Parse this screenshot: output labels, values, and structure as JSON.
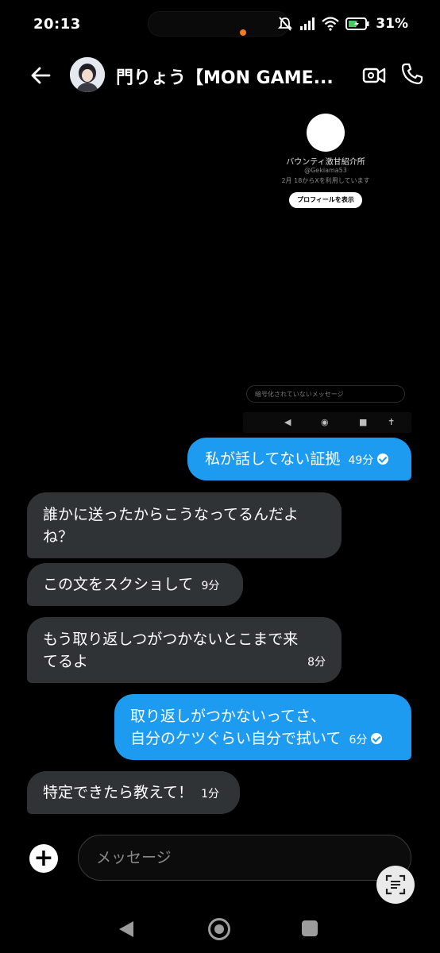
{
  "status": {
    "time": "20:13",
    "battery": "31%"
  },
  "header": {
    "title": "門りょう【MON GAME..."
  },
  "profile_card": {
    "emoji": "😂",
    "name": "バウンティ激甘紹介所",
    "handle": "@Gekiama53",
    "since": "2月 18からXを利用しています",
    "button": "プロフィールを表示"
  },
  "embedded": {
    "input_placeholder": "暗号化されていないメッセージ"
  },
  "messages": [
    {
      "dir": "out",
      "lines": [
        "私が話してない証拠"
      ],
      "time": "49分"
    },
    {
      "dir": "in",
      "lines": [
        "誰かに送ったからこうなってるんだよ",
        "ね？"
      ]
    },
    {
      "dir": "in",
      "lines": [
        "この文をスクショして"
      ],
      "time": "9分"
    },
    {
      "dir": "in",
      "lines": [
        "もう取り返しつがつかないとこまで来",
        "てるよ"
      ],
      "time": "8分"
    },
    {
      "dir": "out",
      "lines": [
        "取り返しがつかないってさ、",
        "自分のケツぐらい自分で拭いて"
      ],
      "time": "6分"
    },
    {
      "dir": "in",
      "lines": [
        "特定できたら教えて！"
      ],
      "time": "1分"
    }
  ],
  "composer": {
    "placeholder": "メッセージ"
  }
}
